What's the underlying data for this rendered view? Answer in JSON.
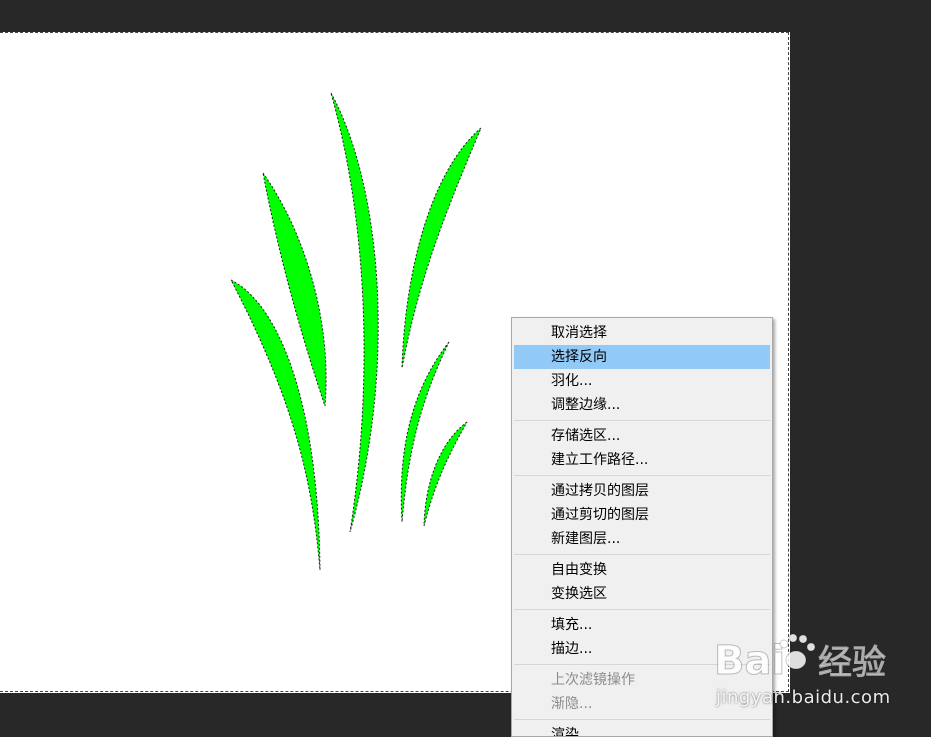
{
  "canvas": {
    "background": "#282828",
    "document_background": "#ffffff",
    "selection_fill": "#00ff00",
    "selection": "marching-ants-icon"
  },
  "context_menu": {
    "highlight_color": "#91c9f7",
    "groups": [
      [
        {
          "label": "取消选择",
          "state": "normal"
        },
        {
          "label": "选择反向",
          "state": "highlighted"
        },
        {
          "label": "羽化...",
          "state": "normal"
        },
        {
          "label": "调整边缘...",
          "state": "normal"
        }
      ],
      [
        {
          "label": "存储选区...",
          "state": "normal"
        },
        {
          "label": "建立工作路径...",
          "state": "normal"
        }
      ],
      [
        {
          "label": "通过拷贝的图层",
          "state": "normal"
        },
        {
          "label": "通过剪切的图层",
          "state": "normal"
        },
        {
          "label": "新建图层...",
          "state": "normal"
        }
      ],
      [
        {
          "label": "自由变换",
          "state": "normal"
        },
        {
          "label": "变换选区",
          "state": "normal"
        }
      ],
      [
        {
          "label": "填充...",
          "state": "normal"
        },
        {
          "label": "描边...",
          "state": "normal"
        }
      ],
      [
        {
          "label": "上次滤镜操作",
          "state": "disabled"
        },
        {
          "label": "渐隐...",
          "state": "disabled"
        }
      ],
      [
        {
          "label": "渲染",
          "state": "normal"
        }
      ]
    ]
  },
  "watermark": {
    "logo_text_latin": "Bai",
    "logo_text_cn": "经验",
    "url": "jingyan.baidu.com",
    "logo": "baidu-paw-icon"
  }
}
